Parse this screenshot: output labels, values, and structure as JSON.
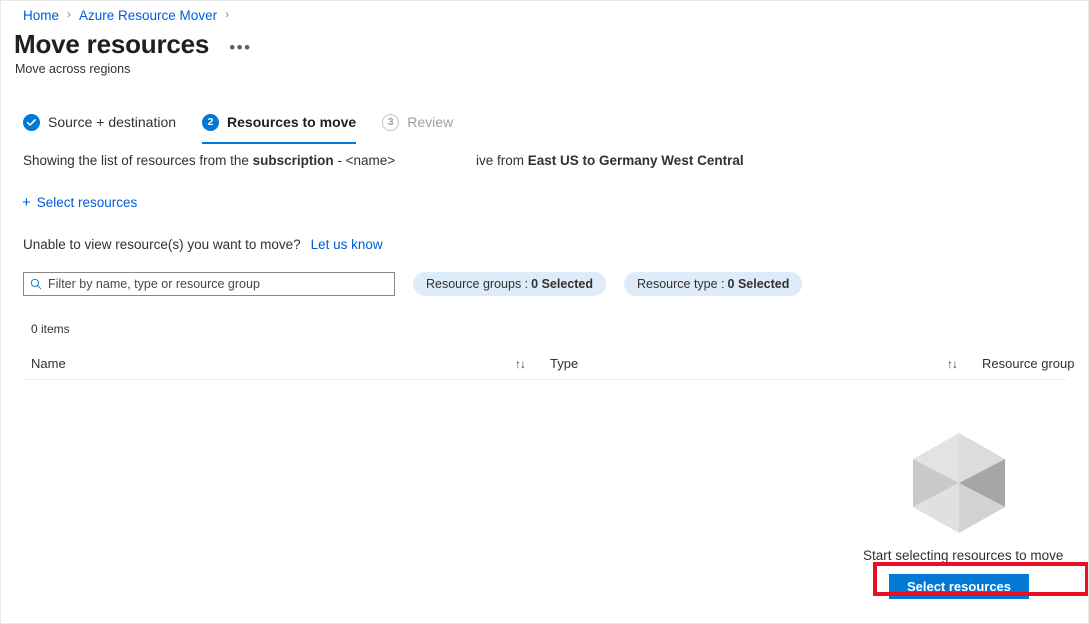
{
  "breadcrumb": {
    "items": [
      {
        "label": "Home"
      },
      {
        "label": "Azure Resource Mover"
      }
    ],
    "separator": "›"
  },
  "header": {
    "title": "Move resources",
    "subtitle": "Move across regions",
    "more_label": "•••"
  },
  "stepper": {
    "steps": [
      {
        "marker": "✓",
        "label": "Source + destination",
        "state": "done"
      },
      {
        "marker": "2",
        "label": "Resources to move",
        "state": "active"
      },
      {
        "marker": "3",
        "label": "Review",
        "state": "pending"
      }
    ]
  },
  "description": {
    "prefix": "Showing the list of resources from the ",
    "bold": "subscription",
    "suffix": " - <name>",
    "right_prefix": "ive from ",
    "right_bold": "East US to Germany West Central"
  },
  "commands": {
    "select_resources_plus": "+",
    "select_resources_label": "Select resources"
  },
  "notice": {
    "text": "Unable to view resource(s) you want to move?",
    "link": "Let us know"
  },
  "filters": {
    "search_placeholder": "Filter by name, type or resource group",
    "search_value": "",
    "search_icon": "search-icon",
    "pills": [
      {
        "label": "Resource groups :",
        "value": "0 Selected"
      },
      {
        "label": "Resource type :",
        "value": "0 Selected"
      }
    ]
  },
  "table": {
    "item_count": "0 items",
    "columns": [
      {
        "label": "Name"
      },
      {
        "label": "Type"
      },
      {
        "label": "Resource group"
      }
    ],
    "sort_glyph": "↑↓",
    "rows": []
  },
  "empty_state": {
    "icon": "cube-icon",
    "message": "Start selecting resources to move",
    "button_label": "Select resources"
  },
  "colors": {
    "accent": "#0078d4",
    "link": "#015cda",
    "pill_bg": "#deecf9",
    "highlight": "#e81123",
    "text": "#323130"
  }
}
